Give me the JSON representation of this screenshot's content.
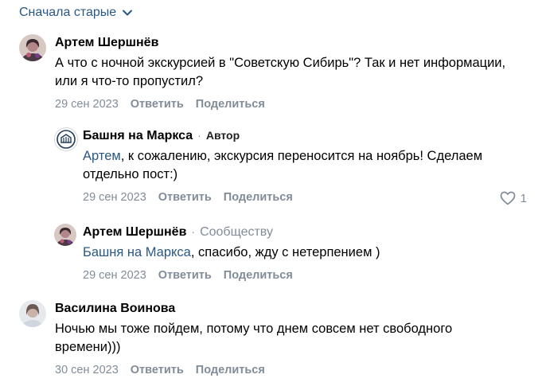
{
  "sort": {
    "label": "Сначала старые",
    "icon": "chevron-down-icon"
  },
  "comments": [
    {
      "author": "Артем Шершнёв",
      "text": "А что с ночной экскурсией в \"Советскую Сибирь\"? Так и нет информации, или я что-то пропустил?",
      "date": "29 сен 2023",
      "reply": "Ответить",
      "share": "Поделиться"
    },
    {
      "author": "Башня на Маркса",
      "badge": "Автор",
      "mention": "Артем",
      "text": ", к сожалению, экскурсия переносится на ноябрь! Сделаем отдельно пост:)",
      "date": "29 сен 2023",
      "reply": "Ответить",
      "share": "Поделиться",
      "likes": "1"
    },
    {
      "author": "Артем Шершнёв",
      "badge": "Сообществу",
      "mention": "Башня на Маркса",
      "text": ", спасибо, жду с нетерпением )",
      "date": "29 сен 2023",
      "reply": "Ответить",
      "share": "Поделиться"
    },
    {
      "author": "Василина Воинова",
      "text": "Ночью мы тоже пойдем, потому что днем совсем нет свободного времени)))",
      "date": "30 сен 2023",
      "reply": "Ответить",
      "share": "Поделиться"
    }
  ],
  "colors": {
    "link": "#2a5885",
    "muted": "#818c99"
  }
}
